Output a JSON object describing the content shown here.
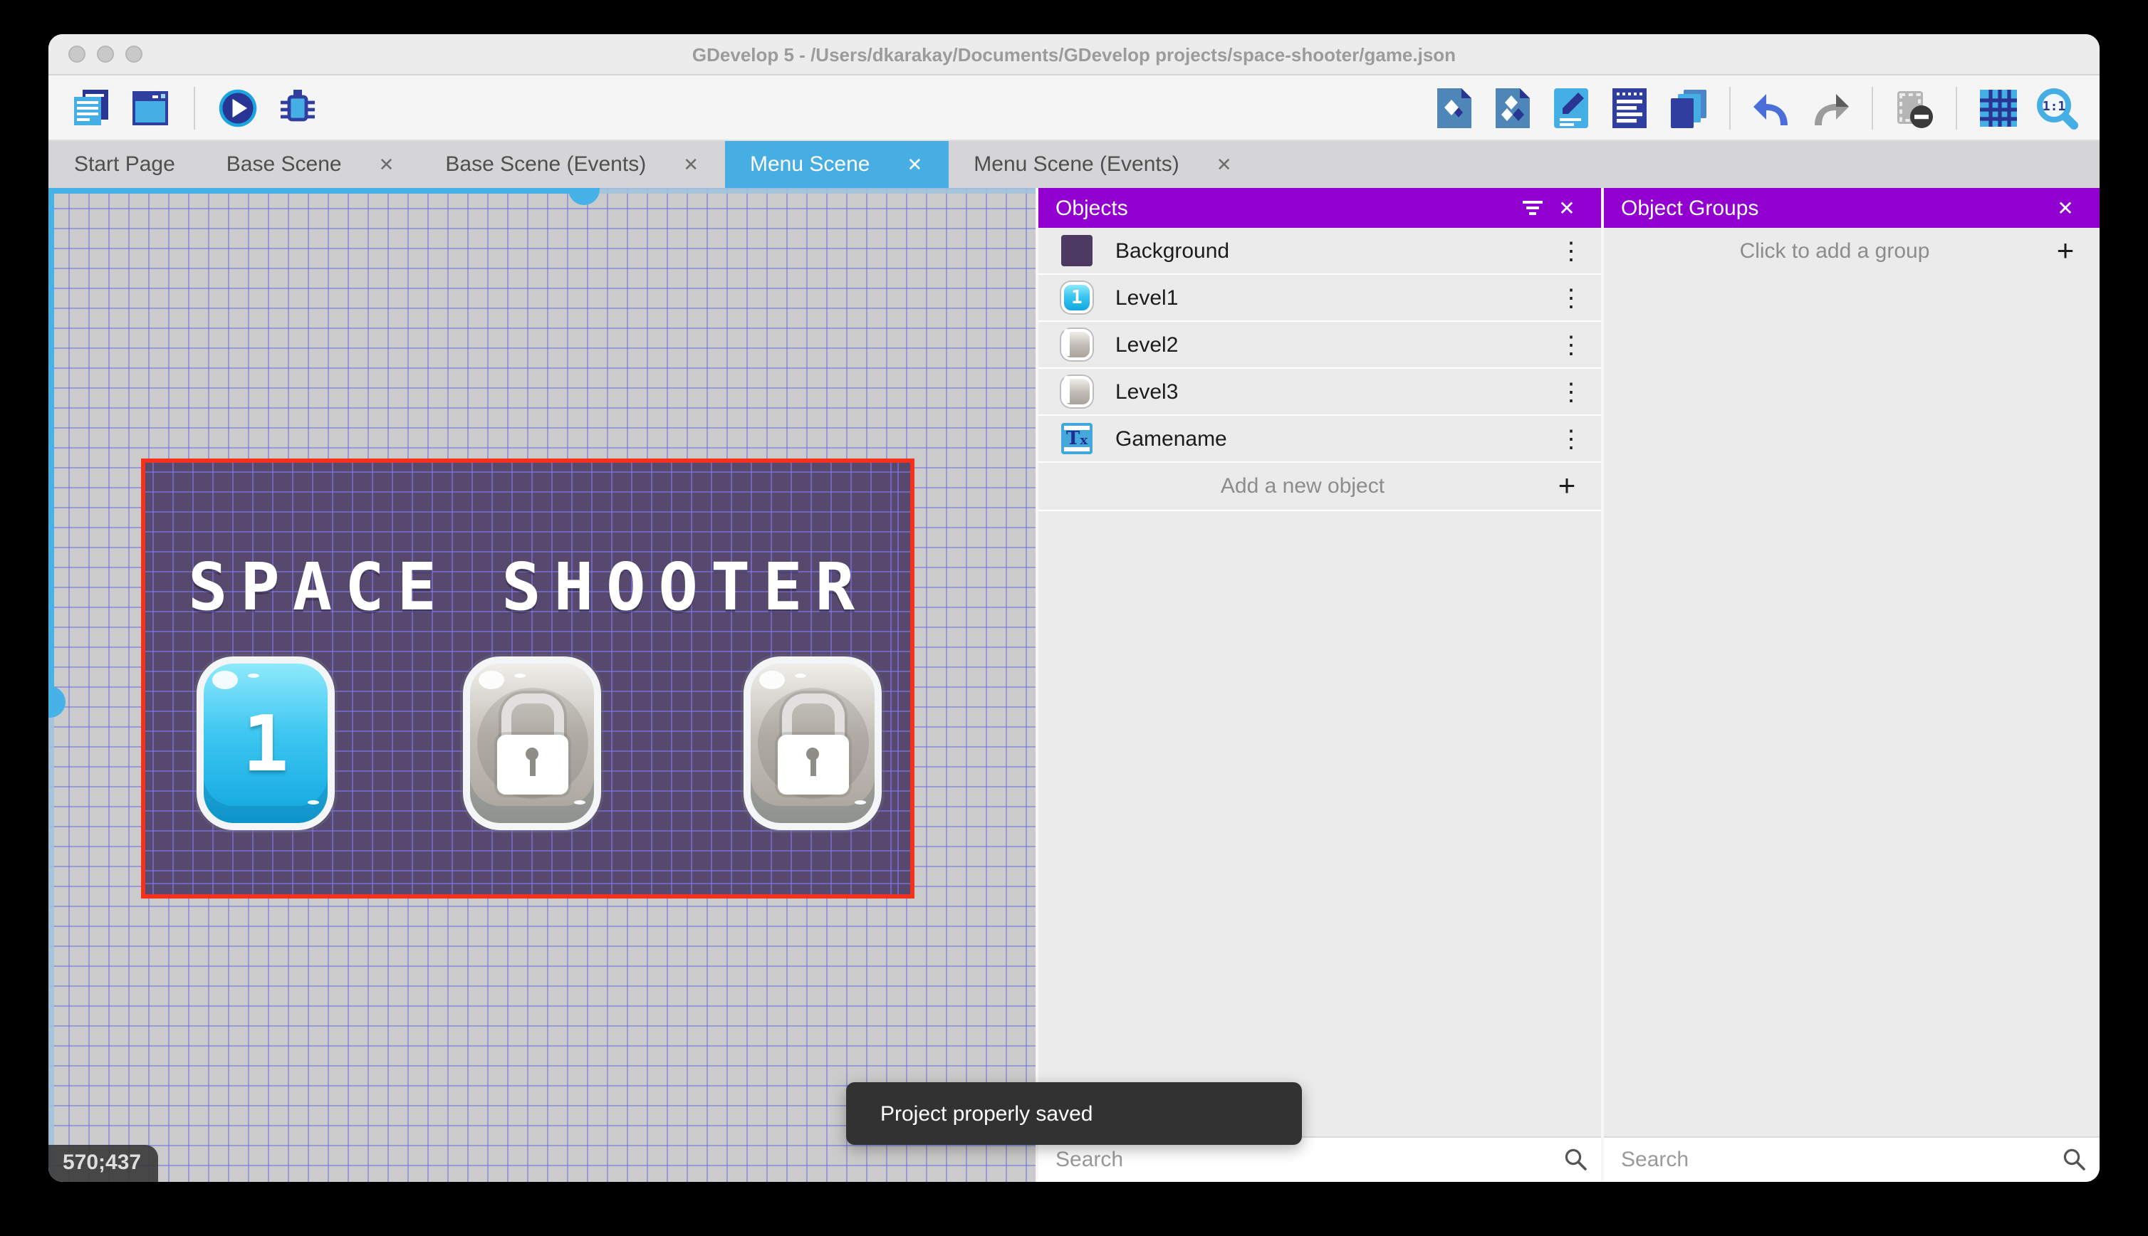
{
  "window": {
    "title": "GDevelop 5 - /Users/dkarakay/Documents/GDevelop projects/space-shooter/game.json"
  },
  "glyphs": {
    "close": "✕",
    "more": "⋮",
    "plus": "+",
    "text_T": "T",
    "text_x": "x"
  },
  "tabs": [
    {
      "label": "Start Page",
      "closable": false,
      "active": false
    },
    {
      "label": "Base Scene",
      "closable": true,
      "active": false
    },
    {
      "label": "Base Scene (Events)",
      "closable": true,
      "active": false
    },
    {
      "label": "Menu Scene",
      "closable": true,
      "active": true
    },
    {
      "label": "Menu Scene (Events)",
      "closable": true,
      "active": false
    }
  ],
  "toolbar": {
    "left_icons": [
      "project-manager",
      "scene-editor",
      "play",
      "debug"
    ],
    "right_icons": [
      "objects-editor",
      "object-groups-editor",
      "properties",
      "instances-list",
      "layers",
      "undo",
      "redo",
      "mask",
      "grid",
      "zoom-reset"
    ],
    "zoom_label": "1:1"
  },
  "canvas": {
    "coordinates": "570;437",
    "scene": {
      "title": "SPACE SHOOTER",
      "buttons": [
        {
          "name": "Level1",
          "label": "1",
          "locked": false
        },
        {
          "name": "Level2",
          "locked": true
        },
        {
          "name": "Level3",
          "locked": true
        }
      ]
    }
  },
  "objects_panel": {
    "title": "Objects",
    "items": [
      {
        "name": "Background",
        "thumb": "background"
      },
      {
        "name": "Level1",
        "thumb": "level1-button"
      },
      {
        "name": "Level2",
        "thumb": "locked-button"
      },
      {
        "name": "Level3",
        "thumb": "locked-button"
      },
      {
        "name": "Gamename",
        "thumb": "text-object"
      }
    ],
    "add_label": "Add a new object",
    "search_placeholder": "Search"
  },
  "groups_panel": {
    "title": "Object Groups",
    "add_label": "Click to add a group",
    "search_placeholder": "Search"
  },
  "toast": {
    "message": "Project properly saved"
  },
  "colors": {
    "accent_purple": "#9100ce",
    "accent_blue": "#47aee4",
    "selection_red": "#f4321c",
    "scene_background": "#57486e"
  }
}
